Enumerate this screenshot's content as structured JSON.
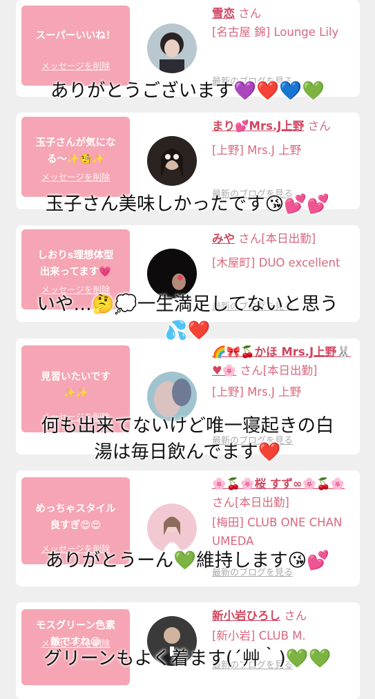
{
  "cards": [
    {
      "bubble": "スーパーいいね！",
      "delete_label": "メッセージを削除",
      "name": "雪恋",
      "san": "さん",
      "shop": "[名古屋 錦] Lounge Lily",
      "blog_label": "最新のブログを見る"
    },
    {
      "bubble": "玉子さんが気にな\nる〜✨🧐✨",
      "delete_label": "メッセージを削除",
      "name": "まり💕Mrs.J上野",
      "san": "さん",
      "shop": "[上野] Mrs.J 上野",
      "blog_label": "最新のブログを見る"
    },
    {
      "bubble": "しおりs理想体型\n出来ってます💗",
      "delete_label": "メッセージを削除",
      "name": "みや",
      "san": "さん[本日出勤]",
      "shop": "[木屋町] DUO excellent",
      "blog_label": "最新のブログを見る"
    },
    {
      "bubble": "見習いたいです\n✨✨",
      "delete_label": "メッセージを削除",
      "name": "🌈🎀🍒かほ Mrs.J上野🐰♥🌸",
      "san": "さん[本日出勤]",
      "shop": "[上野] Mrs.J 上野",
      "blog_label": "最新のブログを見る"
    },
    {
      "bubble": "めっちゃスタイル\n良すぎ😍😍",
      "delete_label": "メッセージを削除",
      "name": "🌸🍒🌸桜 すず∞🌸🍒🌸",
      "san": "さん[本日出勤]",
      "shop": "[梅田] CLUB ONE CHAN UMEDA",
      "blog_label": "最新のブログを見る"
    },
    {
      "bubble": "モスグリーン色素\n敵ですね😁",
      "delete_label": "メッセージを削除",
      "name": "新小岩ひろし",
      "san": "さん",
      "shop": "[新小岩] CLUB M.",
      "blog_label": "最新のブログを見る"
    }
  ],
  "captions": [
    "ありがとうございます💜❤️💙💚",
    "玉子さん美味しかったです😘💕💕",
    "いや…🤔💭一生満足してないと思う",
    "💦❤️",
    "何も出来てないけど唯一寝起きの白",
    "湯は毎日飲んでます❤️",
    "ありがとうーん💚維持します😘💕",
    "グリーンもよく着ます(´艸｀)💚💚"
  ],
  "colors": {
    "bubble": "#f5a5b3",
    "name": "#d1455f",
    "text": "#d8687e",
    "background": "#efefef"
  }
}
